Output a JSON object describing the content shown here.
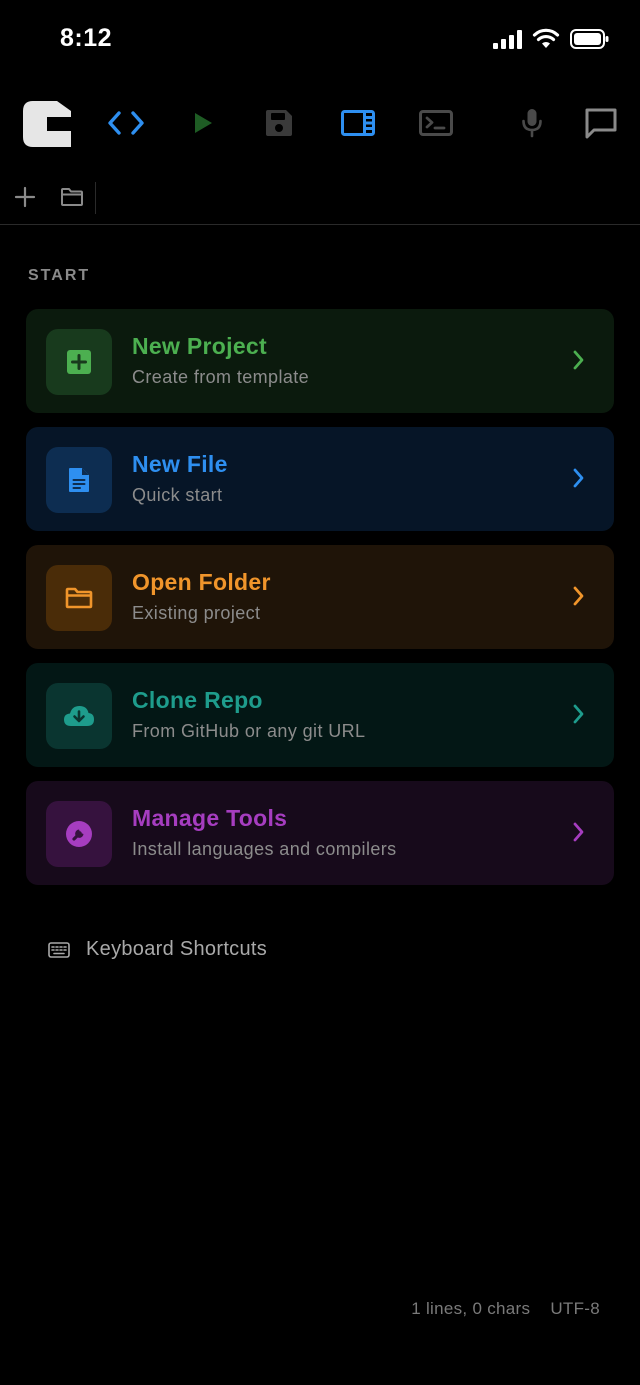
{
  "status_bar": {
    "time": "8:12"
  },
  "section": {
    "title": "START"
  },
  "cards": [
    {
      "title": "New Project",
      "subtitle": "Create from template",
      "icon": "plus-square-icon",
      "accent": "#4caf50",
      "bg": "#0b1a0d",
      "icon_bg": "#183a1d"
    },
    {
      "title": "New File",
      "subtitle": "Quick start",
      "icon": "file-icon",
      "accent": "#2e8ff0",
      "bg": "#061527",
      "icon_bg": "#0d2d51"
    },
    {
      "title": "Open Folder",
      "subtitle": "Existing project",
      "icon": "folder-icon",
      "accent": "#f0952b",
      "bg": "#1f1408",
      "icon_bg": "#4a2c08"
    },
    {
      "title": "Clone Repo",
      "subtitle": "From GitHub or any git URL",
      "icon": "cloud-download-icon",
      "accent": "#1e9c8c",
      "bg": "#031715",
      "icon_bg": "#0a3530"
    },
    {
      "title": "Manage Tools",
      "subtitle": "Install languages and compilers",
      "icon": "wrench-icon",
      "accent": "#a63dc0",
      "bg": "#170a1b",
      "icon_bg": "#36123e"
    }
  ],
  "links": {
    "keyboard_shortcuts": "Keyboard Shortcuts"
  },
  "footer": {
    "stats": "1 lines, 0 chars",
    "encoding": "UTF-8"
  }
}
